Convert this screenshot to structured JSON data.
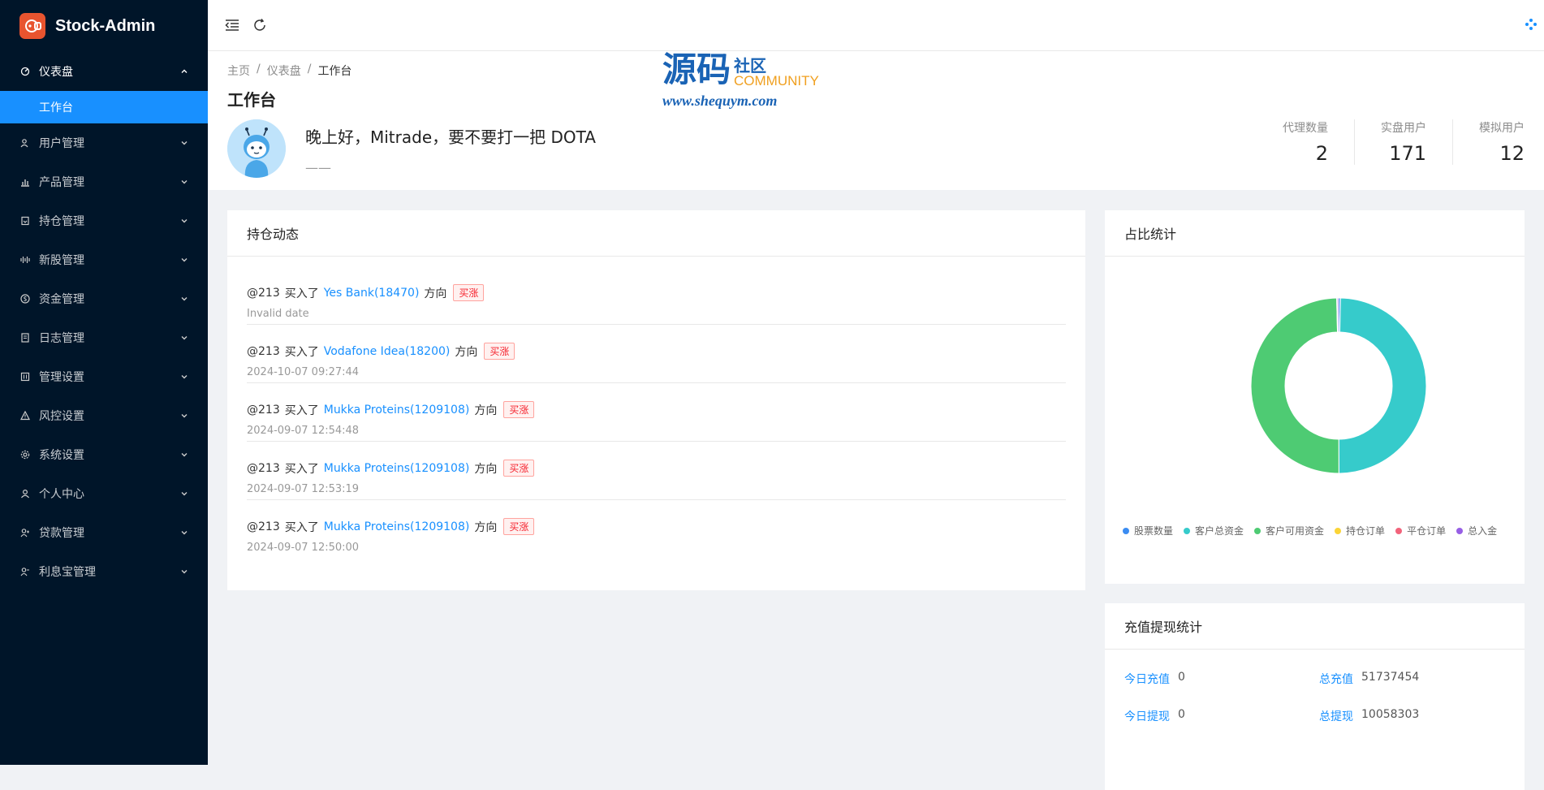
{
  "app": {
    "title": "Stock-Admin"
  },
  "sidebar": {
    "groups": [
      {
        "label": "仪表盘",
        "icon": "dashboard-icon",
        "open": true,
        "sub": [
          "工作台"
        ]
      },
      {
        "label": "用户管理",
        "icon": "user-group-icon"
      },
      {
        "label": "产品管理",
        "icon": "bar-chart-icon"
      },
      {
        "label": "持仓管理",
        "icon": "box-icon"
      },
      {
        "label": "新股管理",
        "icon": "signal-icon"
      },
      {
        "label": "资金管理",
        "icon": "dollar-icon"
      },
      {
        "label": "日志管理",
        "icon": "log-icon"
      },
      {
        "label": "管理设置",
        "icon": "settings-panel-icon"
      },
      {
        "label": "风控设置",
        "icon": "warning-icon"
      },
      {
        "label": "系统设置",
        "icon": "gear-icon"
      },
      {
        "label": "个人中心",
        "icon": "person-icon"
      },
      {
        "label": "贷款管理",
        "icon": "loan-icon"
      },
      {
        "label": "利息宝管理",
        "icon": "interest-icon"
      }
    ]
  },
  "breadcrumb": [
    "主页",
    "仪表盘",
    "工作台"
  ],
  "page": {
    "title": "工作台",
    "greeting": "晚上好，Mitrade，要不要打一把 DOTA",
    "subline": "——"
  },
  "stats": [
    {
      "label": "代理数量",
      "value": "2"
    },
    {
      "label": "实盘用户",
      "value": "171"
    },
    {
      "label": "模拟用户",
      "value": "12"
    }
  ],
  "watermark": {
    "big": "源码",
    "cn": "社区",
    "en": "COMMUNITY",
    "url": "www.shequym.com"
  },
  "feed": {
    "title": "持仓动态",
    "items": [
      {
        "user": "@213",
        "action": "买入了",
        "stock": "Yes Bank(18470)",
        "dir": "方向",
        "tag": "买涨",
        "time": "Invalid date"
      },
      {
        "user": "@213",
        "action": "买入了",
        "stock": "Vodafone Idea(18200)",
        "dir": "方向",
        "tag": "买涨",
        "time": "2024-10-07 09:27:44"
      },
      {
        "user": "@213",
        "action": "买入了",
        "stock": "Mukka Proteins(1209108)",
        "dir": "方向",
        "tag": "买涨",
        "time": "2024-09-07 12:54:48"
      },
      {
        "user": "@213",
        "action": "买入了",
        "stock": "Mukka Proteins(1209108)",
        "dir": "方向",
        "tag": "买涨",
        "time": "2024-09-07 12:53:19"
      },
      {
        "user": "@213",
        "action": "买入了",
        "stock": "Mukka Proteins(1209108)",
        "dir": "方向",
        "tag": "买涨",
        "time": "2024-09-07 12:50:00"
      }
    ]
  },
  "ratio": {
    "title": "占比统计",
    "legend": [
      {
        "name": "股票数量",
        "color": "#3b8cf2"
      },
      {
        "name": "客户总资金",
        "color": "#36cbcb"
      },
      {
        "name": "客户可用资金",
        "color": "#4ecb73"
      },
      {
        "name": "持仓订单",
        "color": "#fbd437"
      },
      {
        "name": "平仓订单",
        "color": "#f2637b"
      },
      {
        "name": "总入金",
        "color": "#975fe5"
      }
    ],
    "colors": [
      "#3b8cf2",
      "#36cbcb",
      "#4ecb73",
      "#fbd437",
      "#f2637b",
      "#975fe5"
    ],
    "values": [
      0.35,
      49.6,
      49.7,
      0.05,
      0.05,
      0.25
    ]
  },
  "recharge": {
    "title": "充值提现统计",
    "items": [
      {
        "label": "今日充值",
        "value": "0"
      },
      {
        "label": "总充值",
        "value": "51737454"
      },
      {
        "label": "今日提现",
        "value": "0"
      },
      {
        "label": "总提现",
        "value": "10058303"
      }
    ]
  }
}
